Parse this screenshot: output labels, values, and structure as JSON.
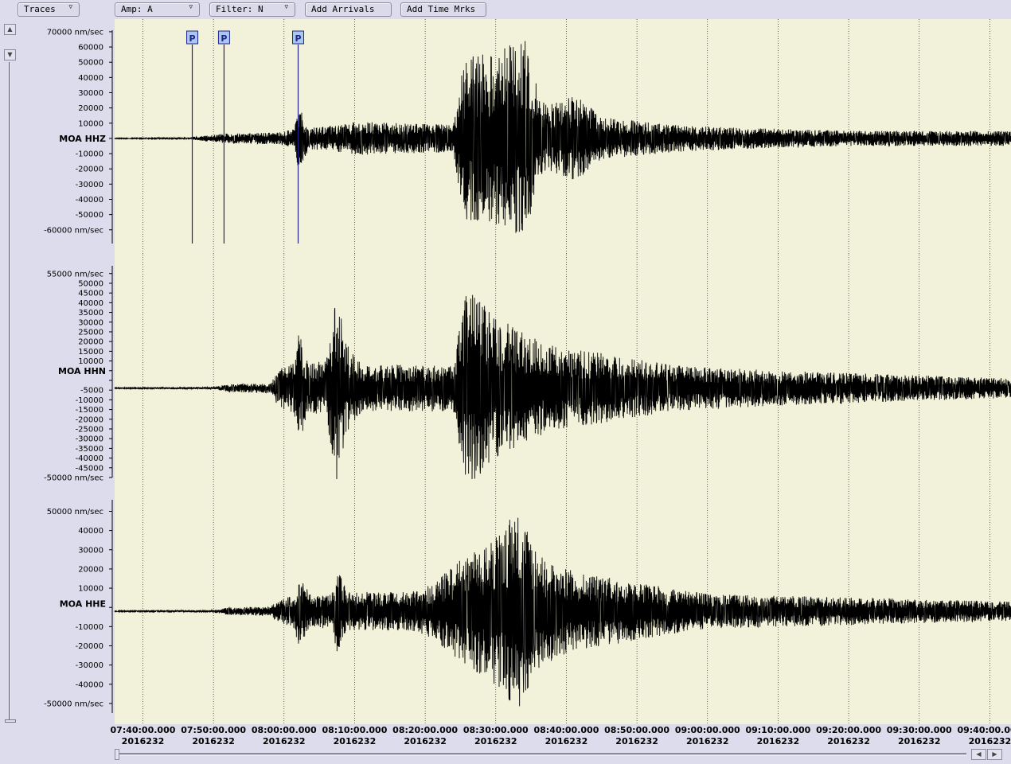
{
  "toolbar": {
    "traces": {
      "label": "Traces",
      "arrow": "▿"
    },
    "amp": {
      "label": "Amp: A",
      "arrow": "▿"
    },
    "filter": {
      "label": "Filter: N",
      "arrow": "▿"
    },
    "add_arrivals": {
      "label": "Add Arrivals"
    },
    "add_time_marks": {
      "label": "Add Time Mrks"
    }
  },
  "scrollbar_icons": {
    "up": "▲",
    "down": "▼",
    "left": "◀",
    "right": "▶"
  },
  "colors": {
    "plot_background": "#f2f2da",
    "chrome": "#dcdcec",
    "trace": "#000000",
    "pick_marker_fill": "#a8c8f0",
    "pick_marker_line": "#23238c"
  },
  "chart_data": {
    "type": "line",
    "x_ticks": [
      {
        "time": "07:40:00.000",
        "day": "2016232"
      },
      {
        "time": "07:50:00.000",
        "day": "2016232"
      },
      {
        "time": "08:00:00.000",
        "day": "2016232"
      },
      {
        "time": "08:10:00.000",
        "day": "2016232"
      },
      {
        "time": "08:20:00.000",
        "day": "2016232"
      },
      {
        "time": "08:30:00.000",
        "day": "2016232"
      },
      {
        "time": "08:40:00.000",
        "day": "2016232"
      },
      {
        "time": "08:50:00.000",
        "day": "2016232"
      },
      {
        "time": "09:00:00.000",
        "day": "2016232"
      },
      {
        "time": "09:10:00.000",
        "day": "2016232"
      },
      {
        "time": "09:20:00.000",
        "day": "2016232"
      },
      {
        "time": "09:30:00.000",
        "day": "2016232"
      },
      {
        "time": "09:40:00.000",
        "day": "2016232"
      }
    ],
    "xlim": [
      "07:36:00",
      "09:43:00"
    ],
    "grid": true,
    "unit": "nm/sec",
    "series": [
      {
        "name": "MOA HHZ",
        "ylim": [
          -69000,
          71000
        ],
        "y_ticks": [
          70000,
          60000,
          50000,
          40000,
          30000,
          20000,
          10000,
          0,
          -10000,
          -20000,
          -30000,
          -40000,
          -50000,
          -60000
        ],
        "y_tick_labels": [
          "70000 nm/sec",
          "60000",
          "50000",
          "40000",
          "30000",
          "20000",
          "10000",
          "",
          "-10000",
          "-20000",
          "-30000",
          "-40000",
          "-50000",
          "-60000 nm/sec"
        ],
        "baseline": 0,
        "label_value": 0,
        "picks": [
          {
            "label": "P",
            "time": "07:47:00"
          },
          {
            "label": "P",
            "time": "07:51:30"
          },
          {
            "label": "P",
            "time": "08:02:00"
          }
        ],
        "envelope": [
          {
            "t": "07:36:00",
            "a": 300
          },
          {
            "t": "07:46:30",
            "a": 500
          },
          {
            "t": "07:51:00",
            "a": 3000
          },
          {
            "t": "07:59:00",
            "a": 4000
          },
          {
            "t": "08:01:30",
            "a": 6000
          },
          {
            "t": "08:02:00",
            "a": 22000
          },
          {
            "t": "08:03:30",
            "a": 7000
          },
          {
            "t": "08:08:00",
            "a": 9000
          },
          {
            "t": "08:10:00",
            "a": 11000
          },
          {
            "t": "08:24:00",
            "a": 9000
          },
          {
            "t": "08:25:00",
            "a": 40000
          },
          {
            "t": "08:26:00",
            "a": 55000
          },
          {
            "t": "08:29:00",
            "a": 55000
          },
          {
            "t": "08:32:00",
            "a": 62000
          },
          {
            "t": "08:34:00",
            "a": 68000
          },
          {
            "t": "08:35:30",
            "a": 40000
          },
          {
            "t": "08:37:00",
            "a": 22000
          },
          {
            "t": "08:41:30",
            "a": 28000
          },
          {
            "t": "08:45:00",
            "a": 14000
          },
          {
            "t": "08:55:00",
            "a": 9000
          },
          {
            "t": "09:05:00",
            "a": 7000
          },
          {
            "t": "09:20:00",
            "a": 5000
          },
          {
            "t": "09:43:00",
            "a": 5000
          }
        ]
      },
      {
        "name": "MOA HHN",
        "ylim": [
          -50000,
          59000
        ],
        "y_ticks": [
          55000,
          50000,
          45000,
          40000,
          35000,
          30000,
          25000,
          20000,
          15000,
          10000,
          5000,
          0,
          -5000,
          -10000,
          -15000,
          -20000,
          -25000,
          -30000,
          -35000,
          -40000,
          -45000,
          -50000
        ],
        "y_tick_labels": [
          "55000 nm/sec",
          "50000",
          "45000",
          "40000",
          "35000",
          "30000",
          "25000",
          "20000",
          "15000",
          "10000",
          "",
          "",
          "-5000",
          "-10000",
          "-15000",
          "-20000",
          "-25000",
          "-30000",
          "-35000",
          "-40000",
          "-45000",
          "-50000 nm/sec"
        ],
        "baseline": -4000,
        "label_value": 5000,
        "picks": [],
        "envelope": [
          {
            "t": "07:36:00",
            "a": 300
          },
          {
            "t": "07:50:00",
            "a": 600
          },
          {
            "t": "07:52:00",
            "a": 2000
          },
          {
            "t": "07:58:00",
            "a": 2500
          },
          {
            "t": "07:59:00",
            "a": 9000
          },
          {
            "t": "08:01:30",
            "a": 14000
          },
          {
            "t": "08:02:00",
            "a": 30000
          },
          {
            "t": "08:03:30",
            "a": 12000
          },
          {
            "t": "08:06:00",
            "a": 15000
          },
          {
            "t": "08:07:30",
            "a": 50000
          },
          {
            "t": "08:09:00",
            "a": 22000
          },
          {
            "t": "08:11:00",
            "a": 12000
          },
          {
            "t": "08:24:00",
            "a": 12000
          },
          {
            "t": "08:25:00",
            "a": 35000
          },
          {
            "t": "08:26:00",
            "a": 52000
          },
          {
            "t": "08:29:00",
            "a": 40000
          },
          {
            "t": "08:33:00",
            "a": 30000
          },
          {
            "t": "08:38:00",
            "a": 22000
          },
          {
            "t": "08:45:00",
            "a": 18000
          },
          {
            "t": "08:55:00",
            "a": 12000
          },
          {
            "t": "09:10:00",
            "a": 9000
          },
          {
            "t": "09:43:00",
            "a": 5000
          }
        ]
      },
      {
        "name": "MOA HHE",
        "ylim": [
          -55000,
          56000
        ],
        "y_ticks": [
          50000,
          40000,
          30000,
          20000,
          10000,
          0,
          -10000,
          -20000,
          -30000,
          -40000,
          -50000
        ],
        "y_tick_labels": [
          "50000 nm/sec",
          "40000",
          "30000",
          "20000",
          "10000",
          "",
          "-10000",
          "-20000",
          "-30000",
          "-40000",
          "-50000 nm/sec"
        ],
        "baseline": -2000,
        "label_value": 2000,
        "picks": [],
        "envelope": [
          {
            "t": "07:36:00",
            "a": 300
          },
          {
            "t": "07:50:00",
            "a": 600
          },
          {
            "t": "07:52:00",
            "a": 2000
          },
          {
            "t": "07:58:00",
            "a": 2500
          },
          {
            "t": "07:59:30",
            "a": 6000
          },
          {
            "t": "08:01:30",
            "a": 9000
          },
          {
            "t": "08:02:00",
            "a": 18000
          },
          {
            "t": "08:04:00",
            "a": 8000
          },
          {
            "t": "08:07:00",
            "a": 10000
          },
          {
            "t": "08:07:30",
            "a": 24000
          },
          {
            "t": "08:09:00",
            "a": 10000
          },
          {
            "t": "08:18:00",
            "a": 10000
          },
          {
            "t": "08:21:00",
            "a": 14000
          },
          {
            "t": "08:26:00",
            "a": 30000
          },
          {
            "t": "08:29:00",
            "a": 35000
          },
          {
            "t": "08:32:00",
            "a": 48000
          },
          {
            "t": "08:33:30",
            "a": 52000
          },
          {
            "t": "08:36:00",
            "a": 30000
          },
          {
            "t": "08:40:00",
            "a": 22000
          },
          {
            "t": "08:50:00",
            "a": 15000
          },
          {
            "t": "09:00:00",
            "a": 9000
          },
          {
            "t": "09:43:00",
            "a": 5000
          }
        ]
      }
    ]
  }
}
